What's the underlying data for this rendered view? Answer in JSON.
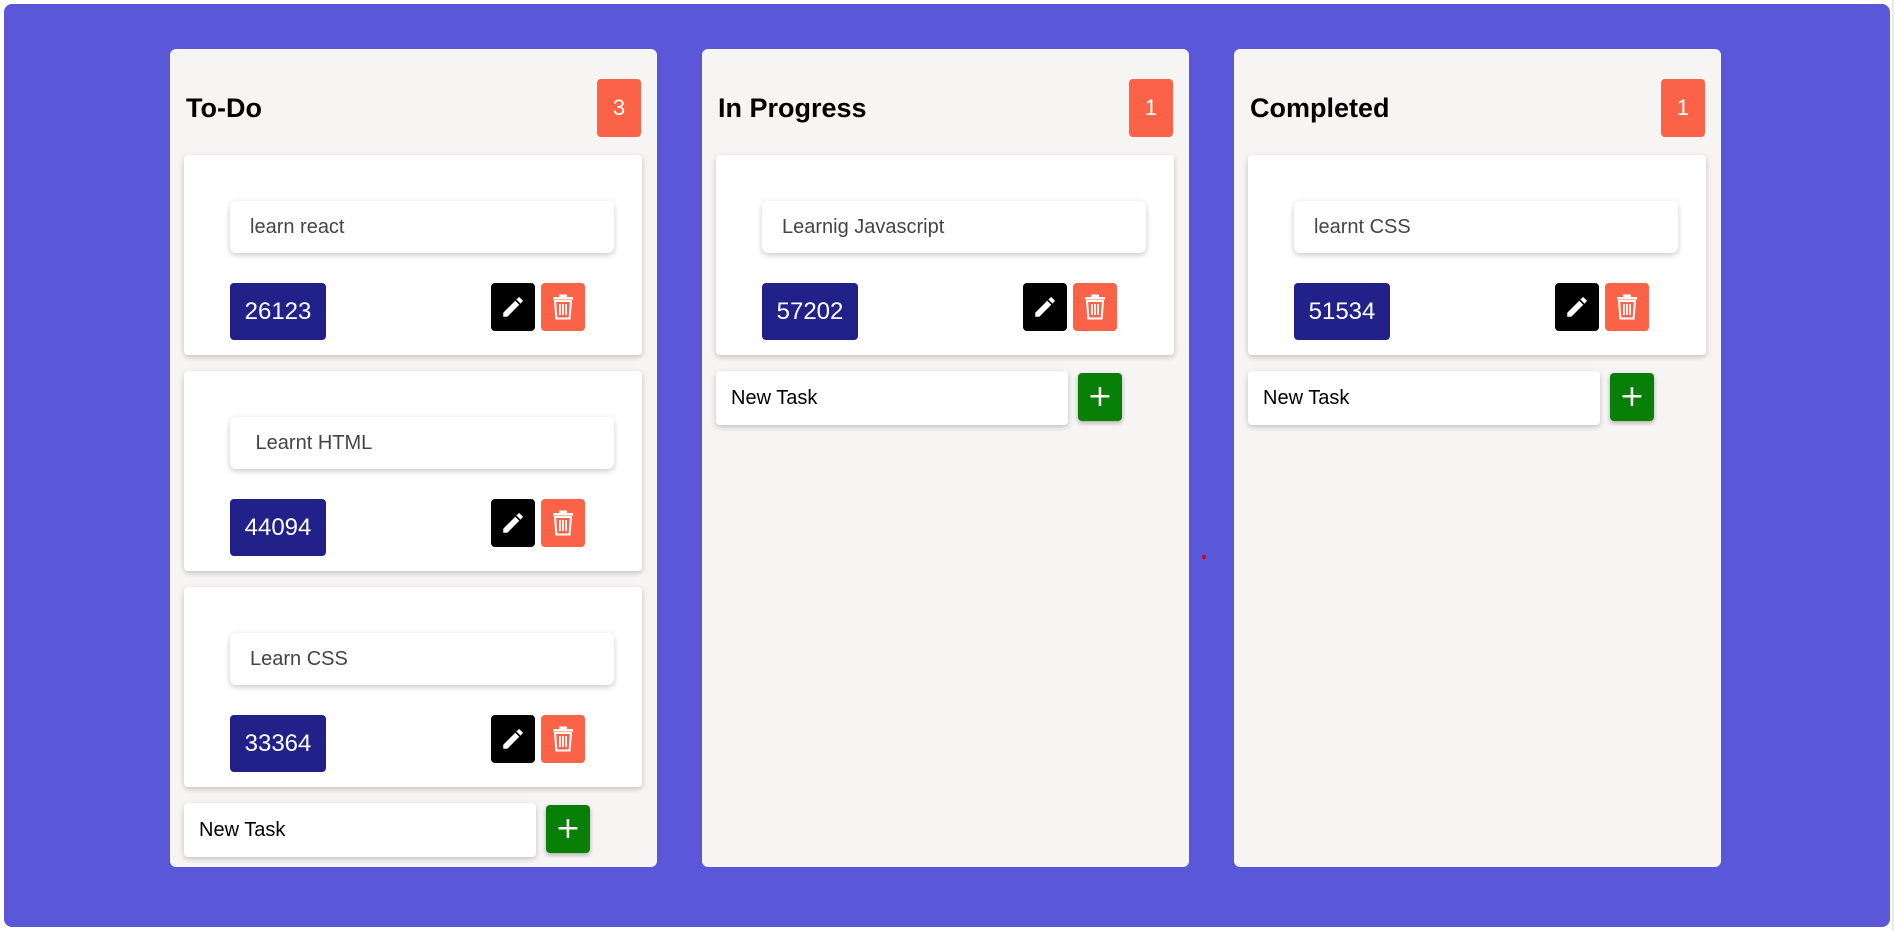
{
  "colors": {
    "board_background": "#5b57d9",
    "column_background": "#f7f5f4",
    "count_badge": "#fa6348",
    "task_id_badge": "#22218a",
    "edit_button": "#000000",
    "delete_button": "#fa6348",
    "add_button": "#088008"
  },
  "icons": {
    "edit": "pencil-icon",
    "delete": "trash-icon",
    "add": "plus-icon"
  },
  "columns": [
    {
      "title": "To-Do",
      "count": "3",
      "tasks": [
        {
          "text": "learn react",
          "id": "26123"
        },
        {
          "text": " Learnt HTML",
          "id": "44094"
        },
        {
          "text": "Learn CSS",
          "id": "33364"
        }
      ],
      "new_task_placeholder": "New Task",
      "add_label": "+"
    },
    {
      "title": "In Progress",
      "count": "1",
      "tasks": [
        {
          "text": "Learnig Javascript",
          "id": "57202"
        }
      ],
      "new_task_placeholder": "New Task",
      "add_label": "+"
    },
    {
      "title": "Completed",
      "count": "1",
      "tasks": [
        {
          "text": "learnt CSS",
          "id": "51534"
        }
      ],
      "new_task_placeholder": "New Task",
      "add_label": "+"
    }
  ]
}
